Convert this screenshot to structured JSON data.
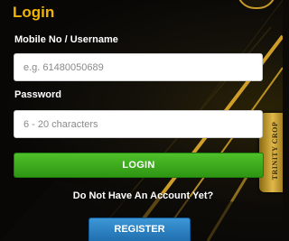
{
  "form": {
    "title": "Login",
    "username_label": "Mobile No / Username",
    "username_placeholder": "e.g. 61480050689",
    "username_value": "",
    "password_label": "Password",
    "password_placeholder": "6 - 20 characters",
    "password_value": "",
    "login_label": "LOGIN",
    "no_account_text": "Do Not Have An Account Yet?",
    "register_label": "REGISTER"
  },
  "background": {
    "badge_text": "TRINITY CROP"
  },
  "colors": {
    "title": "#f0b400",
    "login_button": "#3aa81c",
    "register_button": "#2a7fc0",
    "background": "#0b0a06",
    "gold_accent": "#d4a020"
  }
}
